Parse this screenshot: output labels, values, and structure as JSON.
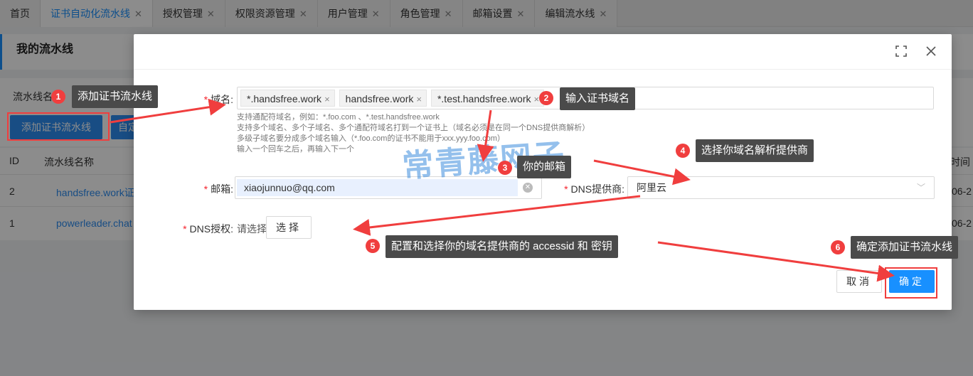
{
  "tabs": [
    {
      "label": "首页",
      "closable": false
    },
    {
      "label": "证书自动化流水线",
      "closable": true,
      "active": true
    },
    {
      "label": "授权管理",
      "closable": true
    },
    {
      "label": "权限资源管理",
      "closable": true
    },
    {
      "label": "用户管理",
      "closable": true
    },
    {
      "label": "角色管理",
      "closable": true
    },
    {
      "label": "邮箱设置",
      "closable": true
    },
    {
      "label": "编辑流水线",
      "closable": true
    }
  ],
  "background": {
    "page_title": "我的流水线",
    "filter_label": "流水线名",
    "add_button": "添加证书流水线",
    "custom_button": "自定",
    "table": {
      "headers": [
        "ID",
        "流水线名称",
        "时间"
      ],
      "rows": [
        {
          "id": "2",
          "name": "handsfree.work证",
          "time": "06-2"
        },
        {
          "id": "1",
          "name": "powerleader.chat",
          "time": "06-2"
        }
      ]
    }
  },
  "modal": {
    "fields": {
      "domain": {
        "label": "域名:",
        "tags": [
          "*.handsfree.work",
          "handsfree.work",
          "*.test.handsfree.work"
        ],
        "help": [
          "支持通配符域名，例如：*.foo.com 、*.test.handsfree.work",
          "支持多个域名、多个子域名、多个通配符域名打到一个证书上（域名必须是在同一个DNS提供商解析）",
          "多级子域名要分成多个域名输入（*.foo.com的证书不能用于xxx.yyy.foo.com）",
          "输入一个回车之后，再输入下一个"
        ]
      },
      "email": {
        "label": "邮箱:",
        "value": "xiaojunnuo@qq.com"
      },
      "dns_provider": {
        "label": "DNS提供商:",
        "value": "阿里云"
      },
      "dns_auth": {
        "label": "DNS授权:",
        "placeholder": "请选择",
        "button": "选择"
      }
    },
    "buttons": {
      "cancel": "取消",
      "ok": "确定"
    }
  },
  "annotations": [
    {
      "num": "1",
      "text": "添加证书流水线"
    },
    {
      "num": "2",
      "text": "输入证书域名"
    },
    {
      "num": "3",
      "text": "你的邮箱"
    },
    {
      "num": "4",
      "text": "选择你域名解析提供商"
    },
    {
      "num": "5",
      "text": "配置和选择你的域名提供商的 accessid 和 密钥"
    },
    {
      "num": "6",
      "text": "确定添加证书流水线"
    }
  ],
  "watermark": "常青藤网子",
  "colors": {
    "primary": "#1890ff",
    "annotation_red": "#f03e3e",
    "callout_bg": "#4a4a4a"
  }
}
